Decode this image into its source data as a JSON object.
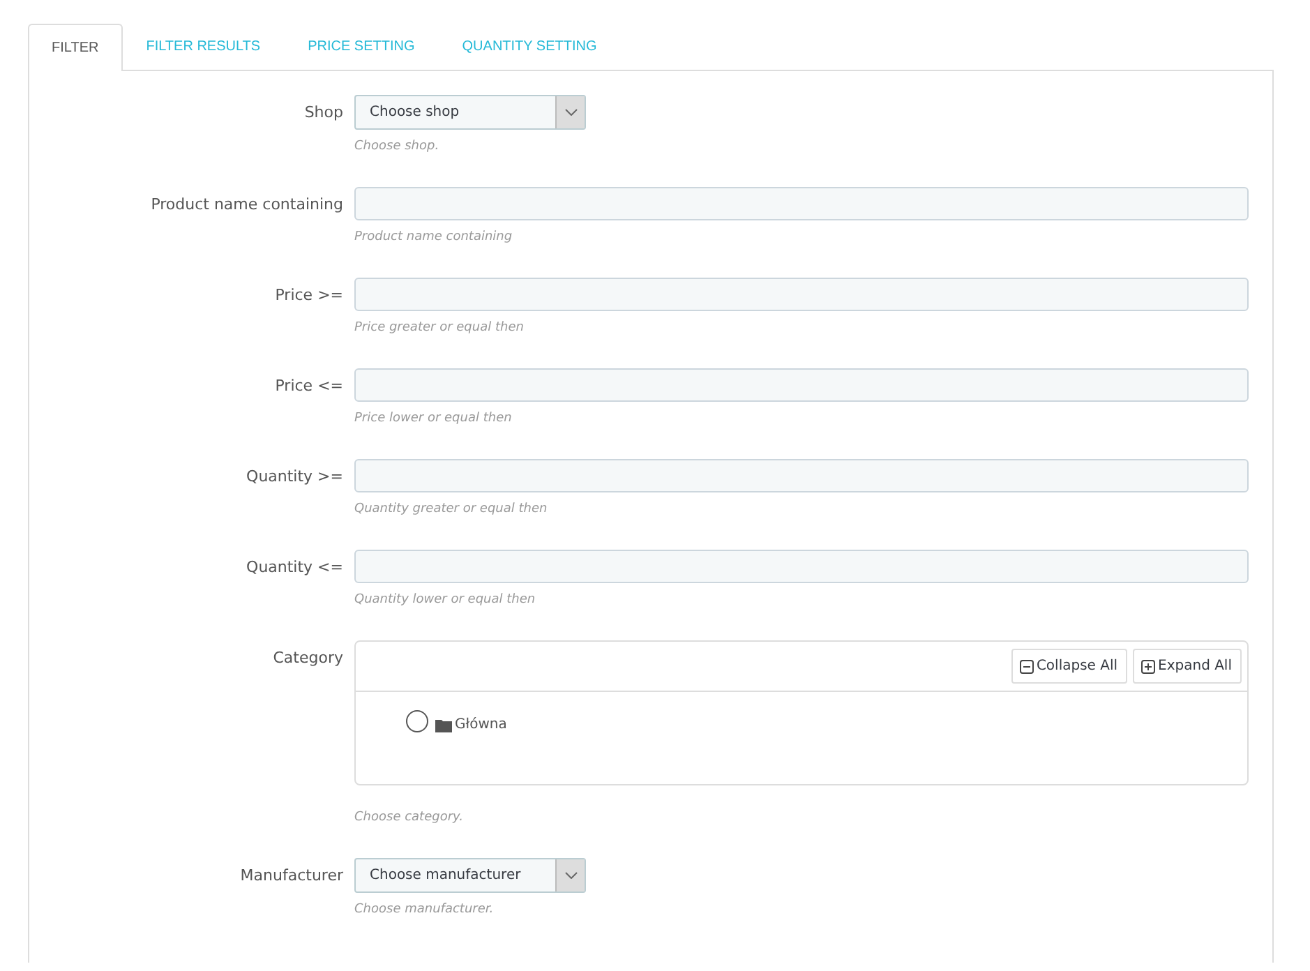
{
  "tabs": [
    {
      "label": "FILTER",
      "selected": true
    },
    {
      "label": "FILTER RESULTS",
      "selected": false
    },
    {
      "label": "PRICE SETTING",
      "selected": false
    },
    {
      "label": "QUANTITY SETTING",
      "selected": false
    }
  ],
  "fields": [
    {
      "kind": "select",
      "label": "Shop",
      "value": "Choose shop",
      "help": "Choose shop."
    },
    {
      "kind": "text",
      "label": "Product name containing",
      "help": "Product name containing"
    },
    {
      "kind": "text",
      "label": "Price >=",
      "help": "Price greater or equal then"
    },
    {
      "kind": "text",
      "label": "Price <=",
      "help": "Price lower or equal then"
    },
    {
      "kind": "text",
      "label": "Quantity >=",
      "help": "Quantity greater or equal then"
    },
    {
      "kind": "text",
      "label": "Quantity <=",
      "help": "Quantity lower or equal then"
    },
    {
      "kind": "tree",
      "label": "Category",
      "buttons": [
        {
          "kind": "collapse",
          "label": "Collapse All"
        },
        {
          "kind": "expand",
          "label": "Expand All"
        }
      ],
      "items": [
        {
          "label": "Główna",
          "selected": false
        }
      ],
      "help": "Choose category."
    },
    {
      "kind": "select",
      "label": "Manufacturer",
      "value": "Choose manufacturer",
      "help": "Choose manufacturer."
    }
  ]
}
